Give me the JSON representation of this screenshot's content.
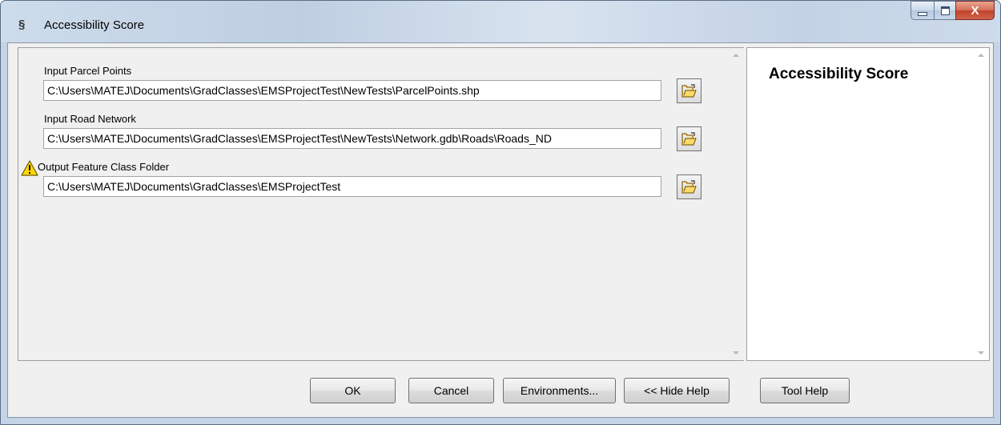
{
  "window": {
    "title": "Accessibility Score",
    "icon": "tool-script-icon",
    "controls": {
      "minimize": "minimize",
      "maximize": "maximize",
      "close": "X"
    }
  },
  "parameters": [
    {
      "label": "Input Parcel Points",
      "value": "C:\\Users\\MATEJ\\Documents\\GradClasses\\EMSProjectTest\\NewTests\\ParcelPoints.shp",
      "warning": false
    },
    {
      "label": "Input Road Network",
      "value": "C:\\Users\\MATEJ\\Documents\\GradClasses\\EMSProjectTest\\NewTests\\Network.gdb\\Roads\\Roads_ND",
      "warning": false
    },
    {
      "label": "Output Feature Class Folder",
      "value": "C:\\Users\\MATEJ\\Documents\\GradClasses\\EMSProjectTest",
      "warning": true
    }
  ],
  "help_panel": {
    "title": "Accessibility Score"
  },
  "buttons": {
    "ok": "OK",
    "cancel": "Cancel",
    "environments": "Environments...",
    "hide_help": "<< Hide Help",
    "tool_help": "Tool Help"
  },
  "icons": {
    "browse": "open-folder-icon",
    "warning": "warning-icon"
  },
  "colors": {
    "titlebar": "#c4d3e6",
    "close_button": "#c0442b",
    "warning_fill": "#ffd800"
  }
}
